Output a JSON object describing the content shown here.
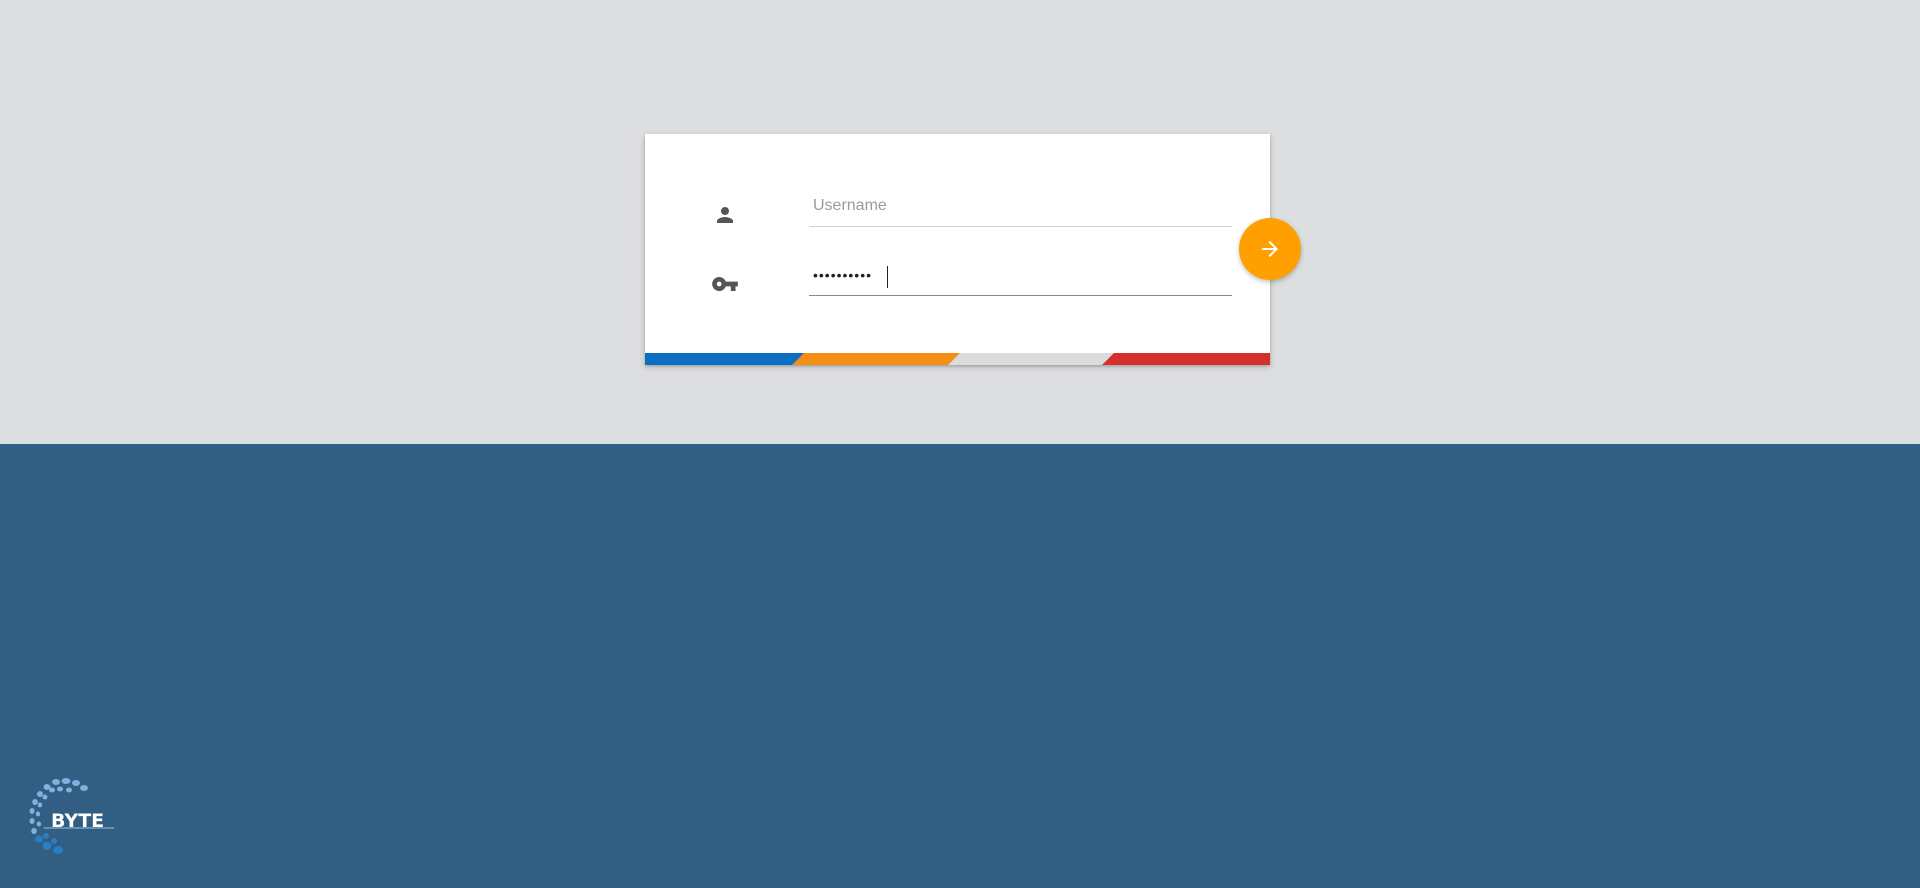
{
  "login": {
    "username": {
      "placeholder": "Username",
      "value": "",
      "icon": "person-icon"
    },
    "password": {
      "placeholder": "",
      "value": "••••••••••",
      "icon": "key-icon"
    },
    "submit_icon": "arrow-right-icon"
  },
  "branding": {
    "logo_text": "BYTE"
  },
  "colors": {
    "background_top": "#dddee0",
    "background_bottom": "#315e82",
    "accent": "#ffa000",
    "stripe_blue": "#0a6fc2",
    "stripe_orange": "#f68d14",
    "stripe_grey": "#dcdcdc",
    "stripe_red": "#d4302b"
  }
}
